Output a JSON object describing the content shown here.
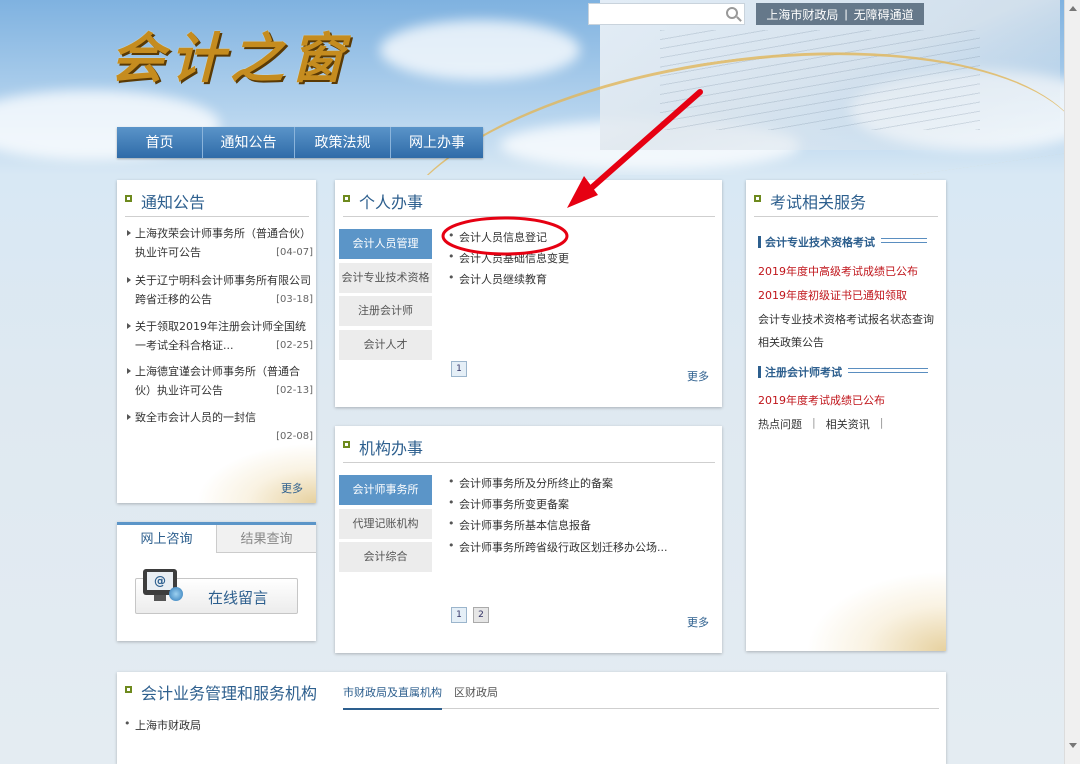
{
  "header": {
    "logo_text": "会计之窗",
    "search_placeholder": "",
    "top_links": [
      "上海市财政局",
      "|",
      "无障碍通道"
    ],
    "nav": [
      "首页",
      "通知公告",
      "政策法规",
      "网上办事"
    ]
  },
  "notice": {
    "title": "通知公告",
    "items": [
      {
        "text": "上海孜荣会计师事务所（普通合伙）执业许可公告",
        "date": "[04-07]"
      },
      {
        "text": "关于辽宁明科会计师事务所有限公司跨省迁移的公告",
        "date": "[03-18]"
      },
      {
        "text": "关于领取2019年注册会计师全国统一考试全科合格证...",
        "date": "[02-25]"
      },
      {
        "text": "上海德宜谨会计师事务所（普通合伙）执业许可公告",
        "date": "[02-13]"
      },
      {
        "text": "致全市会计人员的一封信",
        "date": "[02-08]"
      }
    ],
    "more": "更多"
  },
  "consult": {
    "tabs": [
      "网上咨询",
      "结果查询"
    ],
    "button": "在线留言"
  },
  "personal": {
    "title": "个人办事",
    "tabs": [
      "会计人员管理",
      "会计专业技术资格",
      "注册会计师",
      "会计人才"
    ],
    "items": [
      "会计人员信息登记",
      "会计人员基础信息变更",
      "会计人员继续教育"
    ],
    "page": "1",
    "more": "更多"
  },
  "org": {
    "title": "机构办事",
    "tabs": [
      "会计师事务所",
      "代理记账机构",
      "会计综合"
    ],
    "items": [
      "会计师事务所及分所终止的备案",
      "会计师事务所变更备案",
      "会计师事务所基本信息报备",
      "会计师事务所跨省级行政区划迁移办公场..."
    ],
    "pages": [
      "1",
      "2"
    ],
    "more": "更多"
  },
  "exam": {
    "title": "考试相关服务",
    "section1": "会计专业技术资格考试",
    "s1_items": [
      "2019年度中高级考试成绩已公布",
      "2019年度初级证书已通知领取",
      "会计专业技术资格考试报名状态查询",
      "相关政策公告"
    ],
    "section2": "注册会计师考试",
    "s2_items": [
      "2019年度考试成绩已公布"
    ],
    "links": [
      "热点问题",
      "|",
      "相关资讯",
      "|"
    ]
  },
  "orgs": {
    "title": "会计业务管理和服务机构",
    "tabs": [
      "市财政局及直属机构",
      "区财政局"
    ],
    "items": [
      "上海市财政局"
    ]
  }
}
